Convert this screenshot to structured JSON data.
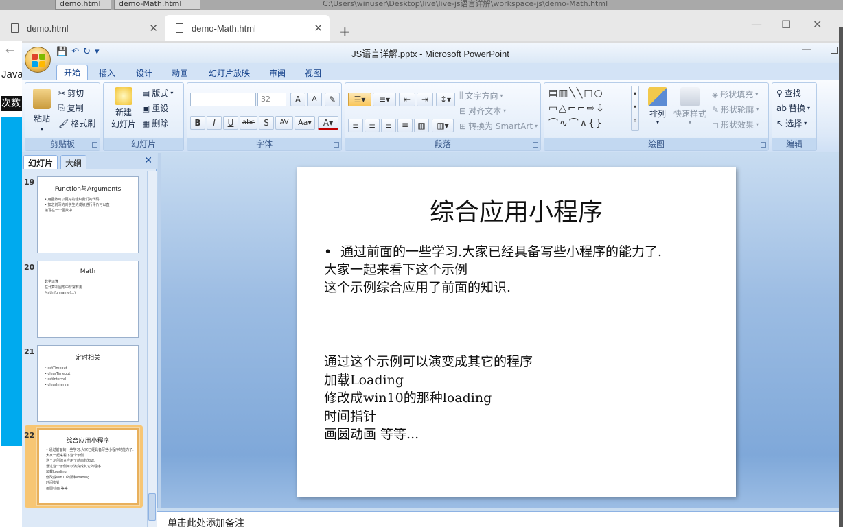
{
  "background_window": {
    "tabs": [
      "demo.html",
      "demo-Math.html"
    ],
    "path": "C:\\Users\\winuser\\Desktop\\live\\live-js语言详解\\workspace-js\\demo-Math.html"
  },
  "browser": {
    "tabs": [
      {
        "label": "demo.html",
        "active": false
      },
      {
        "label": "demo-Math.html",
        "active": true
      }
    ],
    "new_tab": "+",
    "window_controls": {
      "minimize": "—",
      "maximize": "☐",
      "close": "✕"
    },
    "back": "←",
    "page_fragments": {
      "java": "Java",
      "cishu": "次数"
    }
  },
  "powerpoint": {
    "caption": "JS语言详解.pptx - Microsoft PowerPoint",
    "ribbon_tabs": [
      "开始",
      "插入",
      "设计",
      "动画",
      "幻灯片放映",
      "审阅",
      "视图"
    ],
    "active_tab": "开始",
    "groups": {
      "clipboard": {
        "label": "剪贴板",
        "paste": "粘贴",
        "cut": "剪切",
        "copy": "复制",
        "format_painter": "格式刷"
      },
      "slides": {
        "label": "幻灯片",
        "new_slide": "新建",
        "new_slide2": "幻灯片",
        "layout": "版式",
        "reset": "重设",
        "delete": "删除"
      },
      "font": {
        "label": "字体",
        "font_size": "32"
      },
      "paragraph": {
        "label": "段落",
        "text_direction": "文字方向",
        "align_text": "对齐文本",
        "smartart": "转换为 SmartArt"
      },
      "drawing": {
        "label": "绘图",
        "arrange": "排列",
        "quick_styles": "快速样式",
        "shape_fill": "形状填充",
        "shape_outline": "形状轮廓",
        "shape_effects": "形状效果"
      },
      "editing": {
        "label": "编辑",
        "find": "查找",
        "replace": "替换",
        "select": "选择"
      }
    },
    "pane": {
      "tabs": [
        "幻灯片",
        "大纲"
      ],
      "close": "✕",
      "thumbnails": [
        {
          "num": "19",
          "title": "Function与Arguments",
          "lines": [
            "• 用函数可以更好的组织我们的代码",
            "• 如之前写的对学生的成绩进行评价可以直",
            "  接写在一个函数中"
          ]
        },
        {
          "num": "20",
          "title": "Math",
          "lines": [
            "数学运算",
            "在计算机图形中非常有用",
            "Math.funname(...)"
          ]
        },
        {
          "num": "21",
          "title": "定时相关",
          "lines": [
            "• setTimeout",
            "• clearTimeout",
            "• setInterval",
            "• clearInterval"
          ]
        },
        {
          "num": "22",
          "title": "综合应用小程序",
          "lines": [
            "• 通过前面的一些学习.大家已经具备写些小程序的能力了.",
            "大家一起来看下这个示例",
            "这个示例综合应用了前面的知识.",
            "",
            "通过这个示例可以演变成其它的程序",
            "加载Loading",
            "修改成win10的那种loading",
            "时间指针",
            "画圆动画 等等..."
          ]
        }
      ]
    },
    "slide": {
      "title": "综合应用小程序",
      "bullet": "通过前面的一些学习.大家已经具备写些小程序的能力了.",
      "body_lines": [
        "大家一起来看下这个示例",
        "这个示例综合应用了前面的知识."
      ],
      "body2_lines": [
        "通过这个示例可以演变成其它的程序",
        "加载Loading",
        "修改成win10的那种loading",
        "时间指针",
        "画圆动画 等等..."
      ]
    },
    "notes_placeholder": "单击此处添加备注"
  }
}
